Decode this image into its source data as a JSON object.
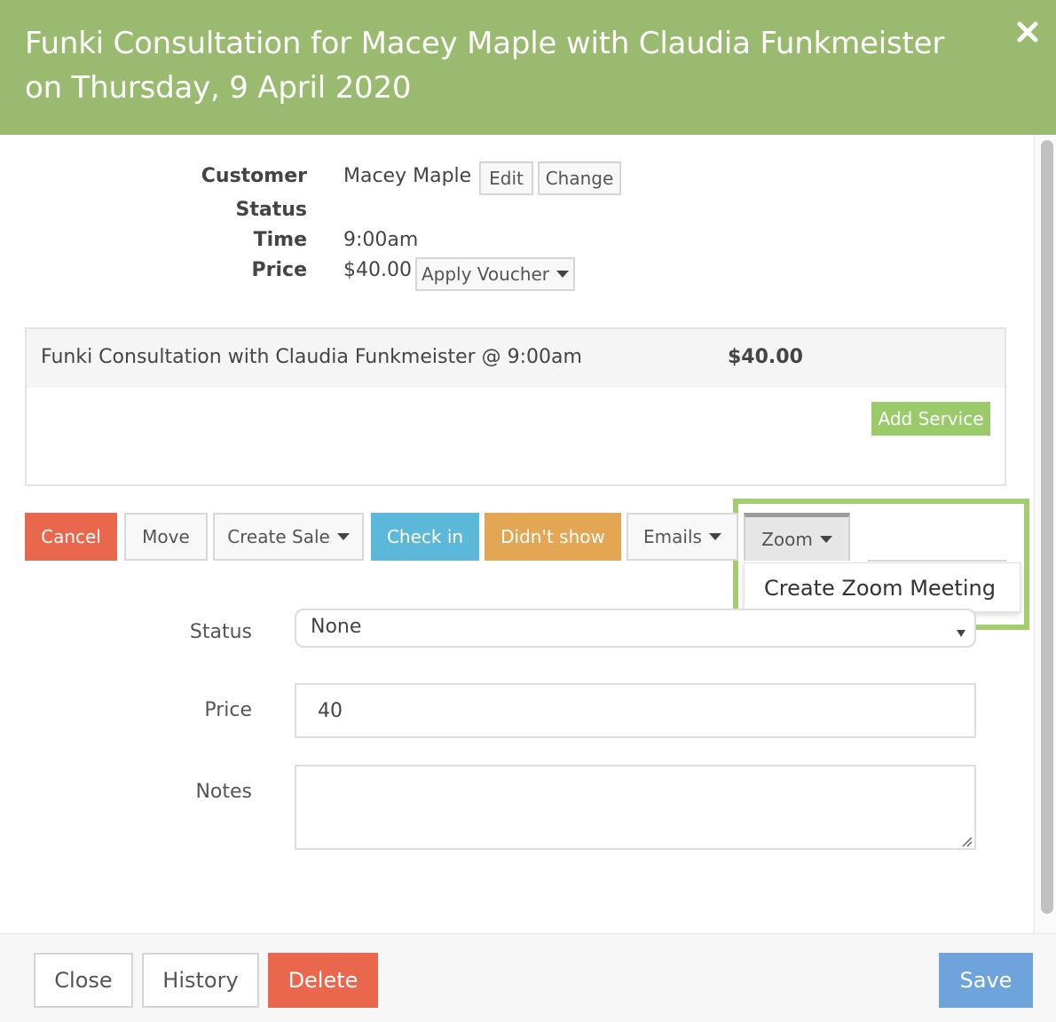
{
  "modal": {
    "title": "Funki Consultation for Macey Maple with Claudia Funkmeister on Thursday, 9 April 2020"
  },
  "details": {
    "customer_label": "Customer",
    "customer_value": "Macey Maple",
    "edit_label": "Edit",
    "change_label": "Change",
    "status_label": "Status",
    "time_label": "Time",
    "time_value": "9:00am",
    "price_label": "Price",
    "price_value": "$40.00",
    "voucher_label": "Apply Voucher"
  },
  "services": {
    "items": [
      {
        "name": "Funki Consultation with Claudia Funkmeister @ 9:00am",
        "price": "$40.00"
      }
    ],
    "add_service_label": "Add Service"
  },
  "actions": {
    "cancel": "Cancel",
    "move": "Move",
    "create_sale": "Create Sale",
    "check_in": "Check in",
    "didnt_show": "Didn't show",
    "emails": "Emails",
    "zoom": "Zoom",
    "zoom_menu": [
      "Create Zoom Meeting"
    ]
  },
  "form": {
    "status_label": "Status",
    "status_value": "None",
    "price_label": "Price",
    "price_value": "40",
    "notes_label": "Notes",
    "notes_value": ""
  },
  "footer": {
    "close": "Close",
    "history": "History",
    "delete": "Delete",
    "save": "Save"
  },
  "colors": {
    "header": "#9aba6f",
    "cancel": "#e8674d",
    "check_in": "#5bb8d8",
    "didnt_show": "#e3a653",
    "add_service": "#9aca6a",
    "save": "#6fa3dc",
    "zoom_highlight": "#a3cd6f"
  }
}
